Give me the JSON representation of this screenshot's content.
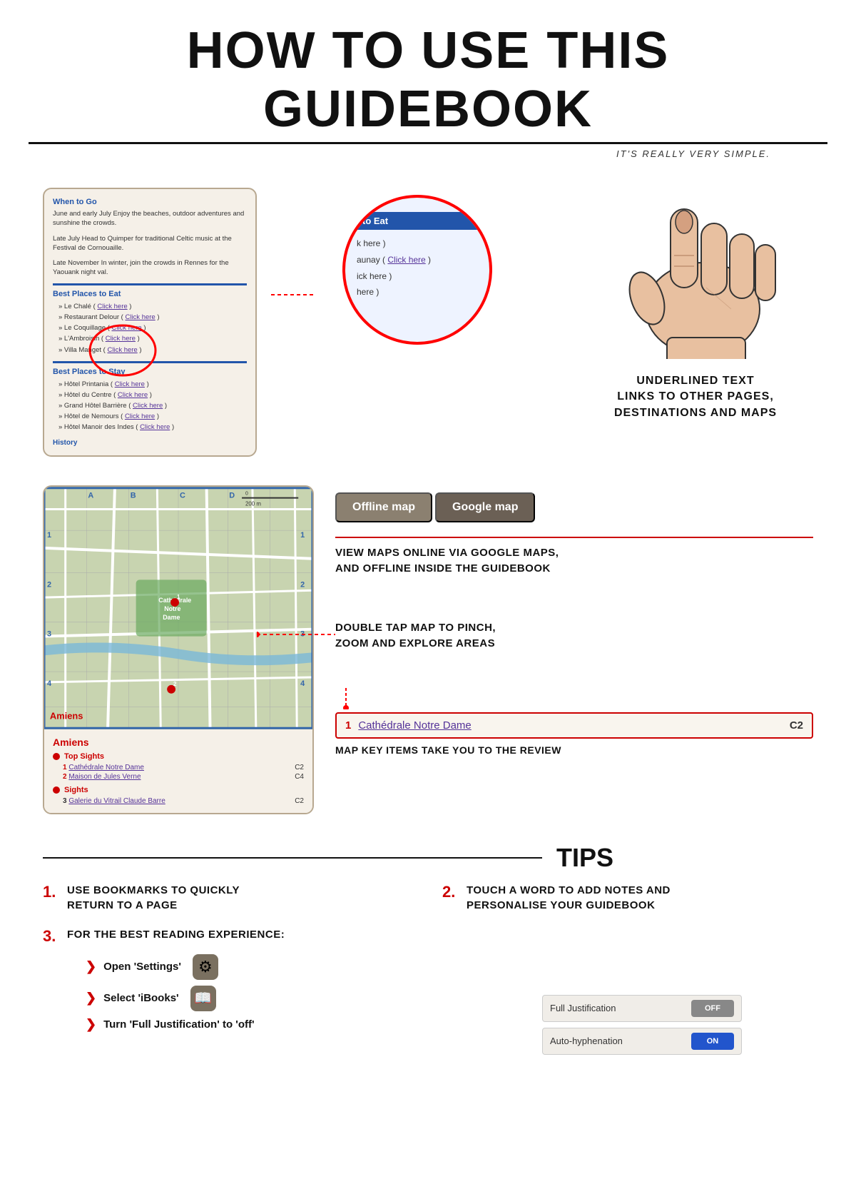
{
  "header": {
    "title": "HOW TO USE THIS GUIDEBOOK",
    "subtitle": "IT'S REALLY VERY SIMPLE."
  },
  "section1": {
    "phone": {
      "when_to_go_title": "When to Go",
      "when_to_go_text1": "June and early July Enjoy the beaches, outdoor adventures and sunshine the crowds.",
      "when_to_go_text2": "Late July Head to Quimper for traditional Celtic music at the Festival de Cornouaille.",
      "when_to_go_text3": "Late November In winter, join the crowds in Rennes for the Yaouank night val.",
      "best_eat_title": "Best Places to Eat",
      "eat_items": [
        "» Le Chalé ( Click here )",
        "» Restaurant Delour ( Click here )",
        "» Le Coquillage ( Click here )",
        "» L'Ambroisin ( Click here )",
        "» Villa Manget ( Click here )"
      ],
      "best_stay_title": "Best Places to Stay",
      "stay_items": [
        "» Hôtel Printania ( Click here )",
        "» Hôtel du Centre ( Click here )",
        "» Grand Hôtel Barrière ( Click here )",
        "» Hôtel de Nemours ( Click here )",
        "» Hôtel Manoir des Indes ( Click here )"
      ],
      "history": "History"
    },
    "zoom": {
      "title": "to Eat",
      "items": [
        "k here )",
        "aunay ( Click here )",
        "ick here )",
        "here )"
      ]
    },
    "label": "UNDERLINED TEXT\nLINKS TO OTHER PAGES,\nDESTINATIONS AND MAPS"
  },
  "section2": {
    "map": {
      "city": "Amiens",
      "top_sights_label": "Top Sights",
      "sights_label": "Sights",
      "items": [
        {
          "num": "1",
          "name": "Cathédrale Notre Dame",
          "grid": "C2"
        },
        {
          "num": "2",
          "name": "Maison de Jules Verne",
          "grid": "C4"
        }
      ],
      "sights_items": [
        {
          "num": "3",
          "name": "Galerie du Vitrail Claude Barre",
          "grid": "C2"
        }
      ]
    },
    "buttons": {
      "offline": "Offline map",
      "google": "Google map"
    },
    "maps_desc": "VIEW MAPS ONLINE VIA GOOGLE MAPS,\nAND OFFLINE INSIDE THE GUIDEBOOK",
    "zoom_desc": "DOUBLE TAP MAP TO PINCH,\nZOOM AND EXPLORE AREAS",
    "key_box": {
      "num": "1",
      "name": "Cathédrale Notre Dame",
      "grid": "C2"
    },
    "key_desc": "MAP KEY ITEMS TAKE YOU TO THE REVIEW"
  },
  "tips": {
    "title": "TIPS",
    "items": [
      {
        "num": "1.",
        "text": "USE BOOKMARKS TO QUICKLY\nRETURN TO A PAGE"
      },
      {
        "num": "2.",
        "text": "TOUCH A WORD TO ADD NOTES AND\nPERSONALISE YOUR GUIDEBOOK"
      }
    ],
    "tip3": {
      "num": "3.",
      "text": "FOR THE BEST READING EXPERIENCE:",
      "steps": [
        {
          "label": "Open 'Settings'",
          "icon": "⚙"
        },
        {
          "label": "Select 'iBooks'",
          "icon": "📖"
        },
        {
          "label": "Turn 'Full Justification' to 'off'",
          "icon": ""
        }
      ]
    },
    "toggles": [
      {
        "label": "Full Justification",
        "value": "OFF",
        "active": false
      },
      {
        "label": "Auto-hyphenation",
        "value": "ON",
        "active": true
      }
    ]
  }
}
